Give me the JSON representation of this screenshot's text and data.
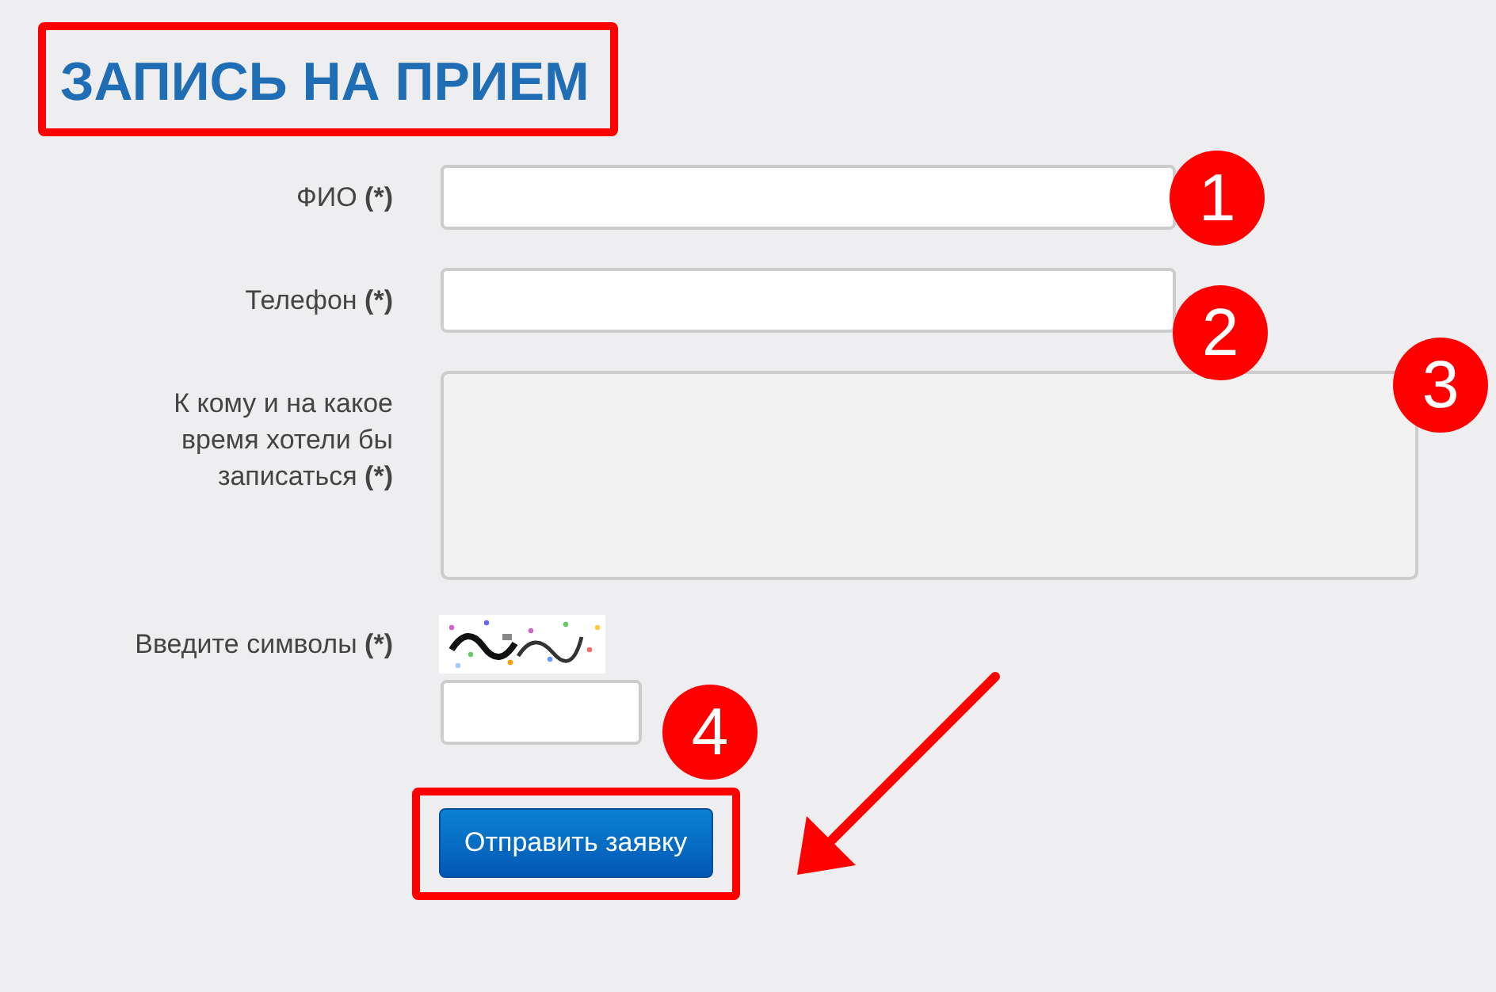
{
  "title": "ЗАПИСЬ НА ПРИЕМ",
  "fields": [
    {
      "kind": "input",
      "label": "ФИО **(*)**"
    },
    {
      "kind": "input",
      "label": "Телефон **(*)**"
    },
    {
      "kind": "textarea",
      "label": "К кому и на какое время хотели бы записаться **(*)**"
    },
    {
      "kind": "captcha",
      "label": "Введите символы **(*)**"
    }
  ],
  "submit": {
    "label": "Отправить заявку"
  },
  "annotations": [
    {
      "number": "1"
    },
    {
      "number": "2"
    },
    {
      "number": "3"
    },
    {
      "number": "4"
    }
  ]
}
